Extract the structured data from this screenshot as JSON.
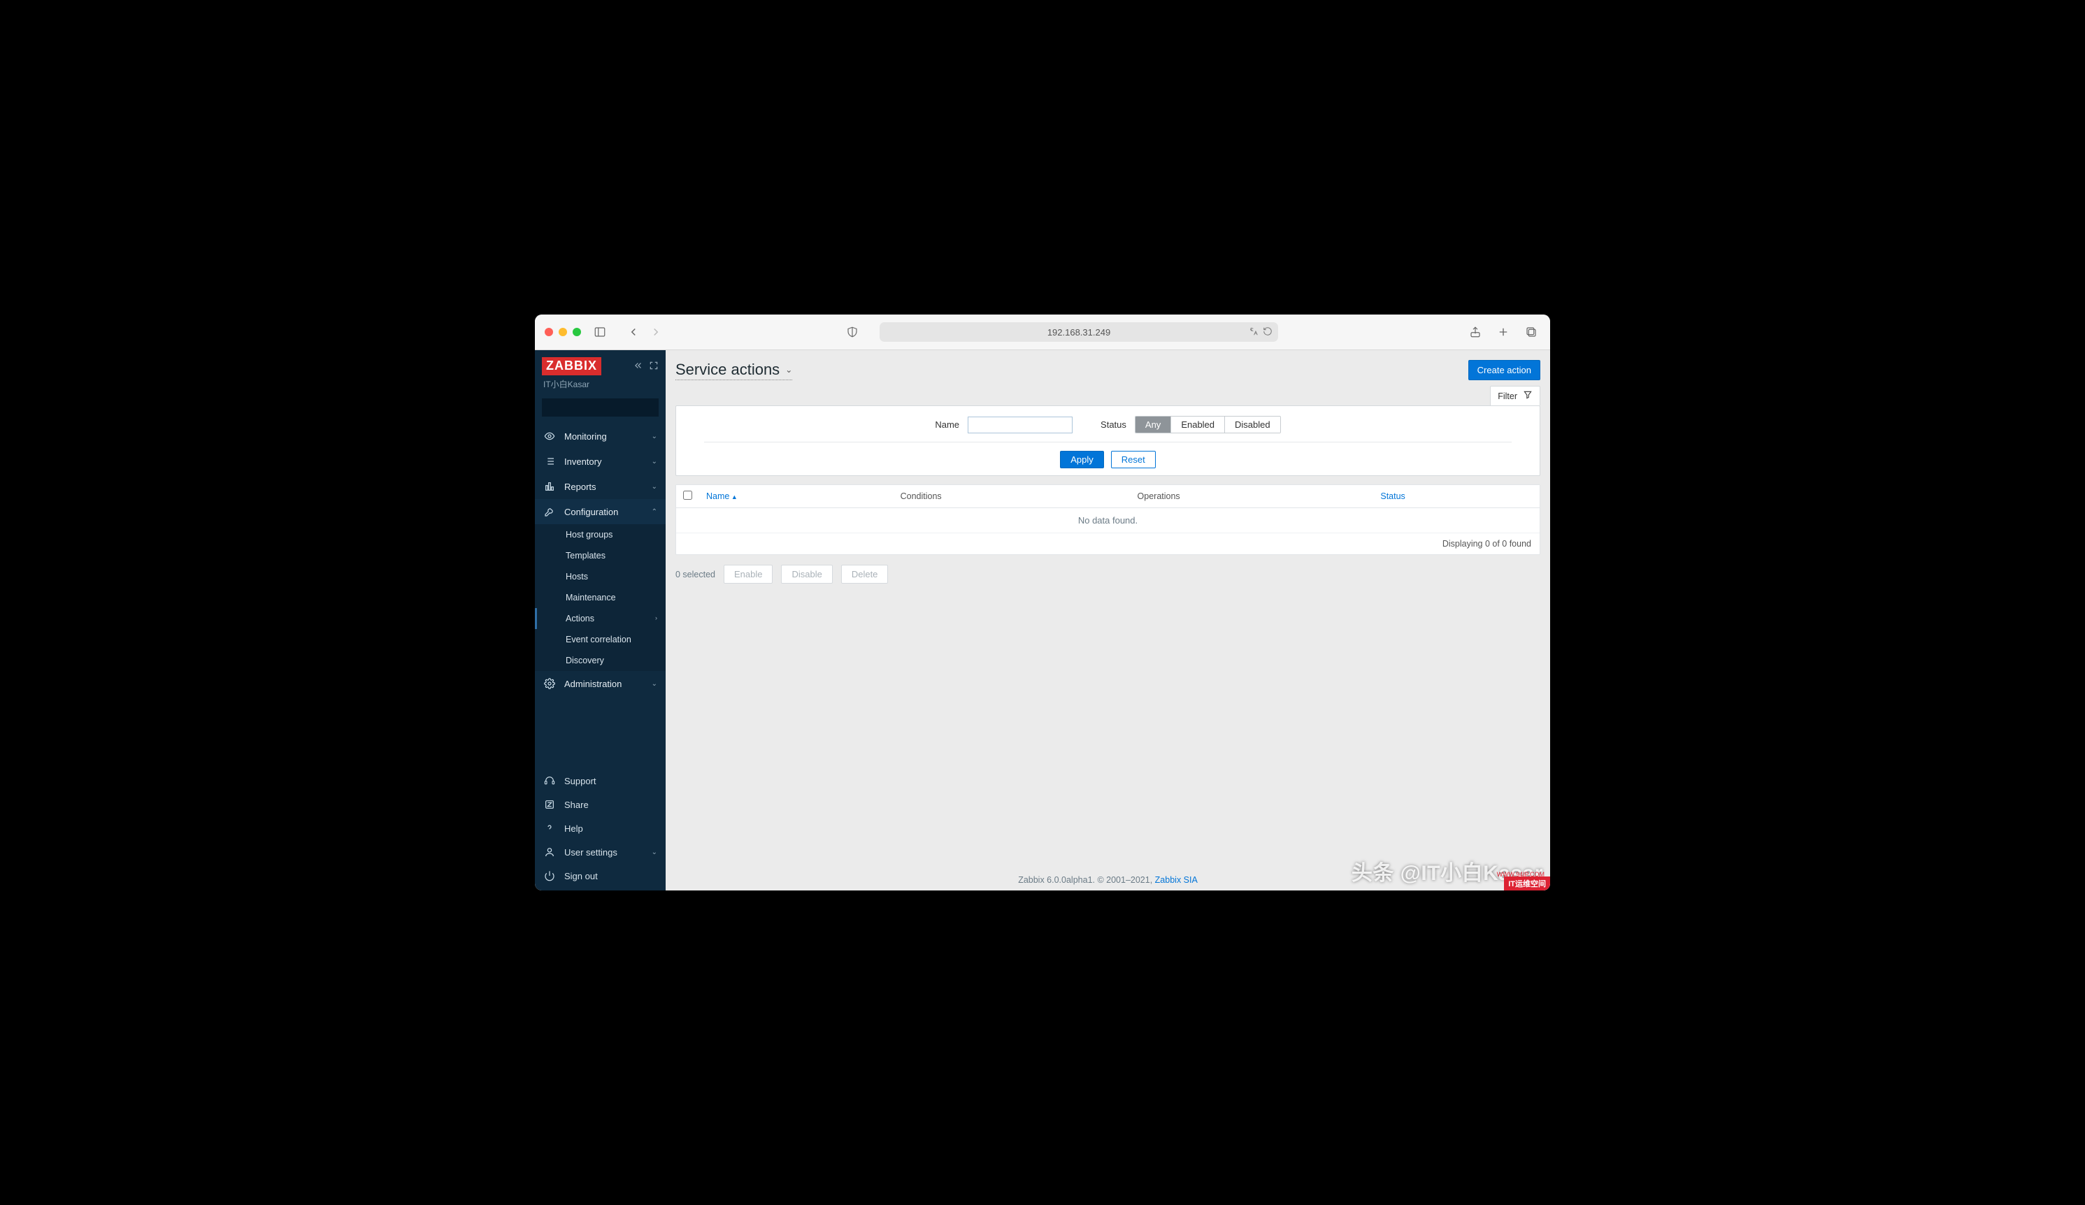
{
  "browser": {
    "address": "192.168.31.249"
  },
  "brand": {
    "logo_text": "ZABBIX",
    "user_label": "IT小白Kasar"
  },
  "sidebar": {
    "search_placeholder": "",
    "sections": [
      {
        "label": "Monitoring",
        "expanded": false
      },
      {
        "label": "Inventory",
        "expanded": false
      },
      {
        "label": "Reports",
        "expanded": false
      },
      {
        "label": "Configuration",
        "expanded": true,
        "items": [
          {
            "label": "Host groups"
          },
          {
            "label": "Templates"
          },
          {
            "label": "Hosts"
          },
          {
            "label": "Maintenance"
          },
          {
            "label": "Actions",
            "active": true,
            "has_children": true
          },
          {
            "label": "Event correlation"
          },
          {
            "label": "Discovery"
          }
        ]
      },
      {
        "label": "Administration",
        "expanded": false
      }
    ],
    "bottom": [
      {
        "label": "Support"
      },
      {
        "label": "Share"
      },
      {
        "label": "Help"
      },
      {
        "label": "User settings",
        "has_children": true
      },
      {
        "label": "Sign out"
      }
    ]
  },
  "page": {
    "title": "Service actions",
    "create_button": "Create action",
    "filter_tab": "Filter"
  },
  "filters": {
    "name_label": "Name",
    "name_value": "",
    "status_label": "Status",
    "status_options": [
      "Any",
      "Enabled",
      "Disabled"
    ],
    "status_selected": "Any",
    "apply": "Apply",
    "reset": "Reset"
  },
  "table": {
    "columns": [
      "Name",
      "Conditions",
      "Operations",
      "Status"
    ],
    "sort_column": "Name",
    "sort_dir": "asc",
    "rows": [],
    "empty_text": "No data found.",
    "displaying_text": "Displaying 0 of 0 found"
  },
  "bulk": {
    "selected_text": "0 selected",
    "enable": "Enable",
    "disable": "Disable",
    "delete": "Delete"
  },
  "footer": {
    "text_prefix": "Zabbix 6.0.0alpha1. © 2001–2021, ",
    "link_text": "Zabbix SIA"
  },
  "watermark": {
    "text": "头条 @IT小白Kasar",
    "badge": "IT运维空间",
    "small": "WWW.94IP.COM"
  }
}
